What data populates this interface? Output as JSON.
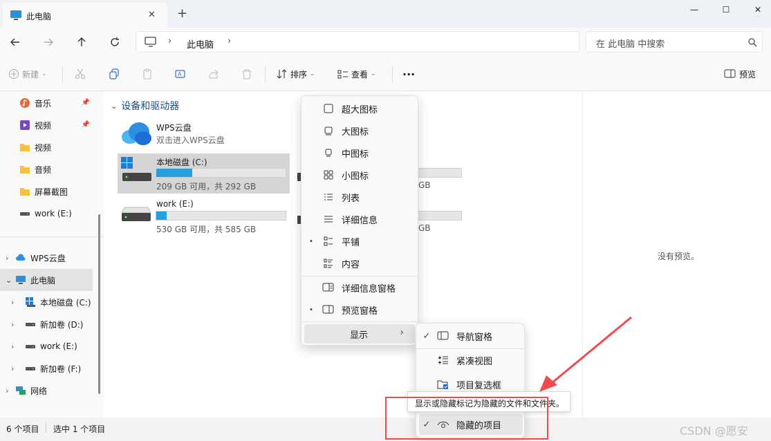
{
  "window": {
    "tab_title": "此电脑",
    "new_tab": "+",
    "minimize": "—",
    "maximize": "☐",
    "close": "✕"
  },
  "nav": {
    "breadcrumb_root": "此电脑",
    "search_placeholder": "在 此电脑 中搜索"
  },
  "toolbar": {
    "new_label": "新建",
    "sort_label": "排序",
    "view_label": "查看",
    "more_label": "···",
    "preview_label": "预览"
  },
  "sidebar": {
    "quick": [
      {
        "label": "音乐",
        "icon": "music-icon",
        "pinned": true
      },
      {
        "label": "视频",
        "icon": "video-icon",
        "pinned": true
      },
      {
        "label": "视频",
        "icon": "folder-icon",
        "pinned": false
      },
      {
        "label": "音频",
        "icon": "folder-icon",
        "pinned": false
      },
      {
        "label": "屏幕截图",
        "icon": "folder-icon",
        "pinned": false
      },
      {
        "label": "work (E:)",
        "icon": "drive-icon",
        "pinned": false
      }
    ],
    "tree": [
      {
        "label": "WPS云盘",
        "icon": "cloud-icon"
      },
      {
        "label": "此电脑",
        "icon": "pc-icon"
      },
      {
        "label": "本地磁盘 (C:)",
        "icon": "windows-drive-icon"
      },
      {
        "label": "新加卷 (D:)",
        "icon": "drive-icon"
      },
      {
        "label": "work (E:)",
        "icon": "drive-icon"
      },
      {
        "label": "新加卷 (F:)",
        "icon": "drive-icon"
      },
      {
        "label": "网络",
        "icon": "network-icon"
      }
    ]
  },
  "content": {
    "group_header": "设备和驱动器",
    "wps": {
      "name": "WPS云盘",
      "desc": "双击进入WPS云盘"
    },
    "drives": [
      {
        "name": "本地磁盘 (C:)",
        "free": "209 GB 可用，共 292 GB",
        "used_fraction": 0.28
      },
      {
        "name": "work (E:)",
        "free": "530 GB 可用，共 585 GB",
        "used_fraction": 0.08
      }
    ],
    "partial_drives": [
      {
        "free_suffix": "GB",
        "used_fraction": 0.2
      },
      {
        "free_suffix": "GB",
        "used_fraction": 0.2
      }
    ]
  },
  "preview": {
    "empty_text": "没有预览。"
  },
  "status": {
    "item_count": "6 个项目",
    "selected": "选中 1 个项目"
  },
  "view_menu": {
    "items": [
      {
        "label": "超大图标",
        "icon": "xl-icons-icon",
        "bullet": ""
      },
      {
        "label": "大图标",
        "icon": "large-icons-icon",
        "bullet": ""
      },
      {
        "label": "中图标",
        "icon": "medium-icons-icon",
        "bullet": ""
      },
      {
        "label": "小图标",
        "icon": "small-icons-icon",
        "bullet": ""
      },
      {
        "label": "列表",
        "icon": "list-icon",
        "bullet": ""
      },
      {
        "label": "详细信息",
        "icon": "details-icon",
        "bullet": ""
      },
      {
        "label": "平铺",
        "icon": "tiles-icon",
        "bullet": "•"
      },
      {
        "label": "内容",
        "icon": "content-icon",
        "bullet": ""
      },
      {
        "label": "详细信息窗格",
        "icon": "details-pane-icon",
        "bullet": ""
      },
      {
        "label": "预览窗格",
        "icon": "preview-pane-icon",
        "bullet": "•"
      }
    ],
    "show_label": "显示",
    "show_arrow": "›"
  },
  "show_menu": {
    "items": [
      {
        "label": "导航窗格",
        "icon": "nav-pane-icon",
        "check": "✓"
      },
      {
        "label": "紧凑视图",
        "icon": "compact-view-icon",
        "check": ""
      },
      {
        "label": "项目复选框",
        "icon": "checkbox-icon",
        "check": ""
      },
      {
        "label": "隐藏的项目",
        "icon": "eye-icon",
        "check": "✓"
      }
    ]
  },
  "tooltip": {
    "text": "显示或隐藏标记为隐藏的文件和文件夹。"
  },
  "watermark": "CSDN @愿安",
  "colors": {
    "accent": "#26a0da",
    "annotation": "#ef4b4b"
  }
}
